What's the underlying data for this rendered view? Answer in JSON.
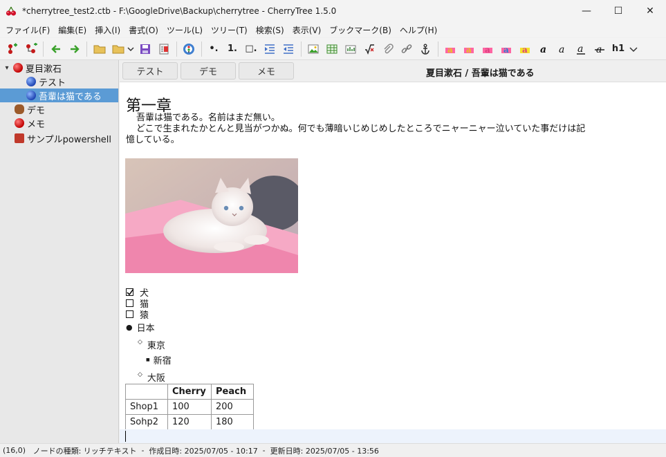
{
  "window": {
    "title": "*cherrytree_test2.ctb - F:\\GoogleDrive\\Backup\\cherrytree - CherryTree 1.5.0",
    "controls": {
      "minimize": "—",
      "maximize": "☐",
      "close": "✕"
    }
  },
  "menu": [
    "ファイル(F)",
    "編集(E)",
    "挿入(I)",
    "書式(O)",
    "ツール(L)",
    "ツリー(T)",
    "検索(S)",
    "表示(V)",
    "ブックマーク(B)",
    "ヘルプ(H)"
  ],
  "toolbar": {
    "heading_label": "h1",
    "list_bullet": "•.",
    "list_number": "1.",
    "list_todo": "□."
  },
  "tree": {
    "items": [
      {
        "label": "夏目漱石",
        "icon": "cherry-icon",
        "level": 0,
        "expanded": true
      },
      {
        "label": "テスト",
        "icon": "blueberry-icon",
        "level": 1
      },
      {
        "label": "吾輩は猫である",
        "icon": "blueberry-icon",
        "level": 1,
        "selected": true
      },
      {
        "label": "デモ",
        "icon": "bear-icon",
        "level": 0
      },
      {
        "label": "メモ",
        "icon": "cherry-icon",
        "level": 0
      },
      {
        "label": "サンプルpowershell",
        "icon": "terminal-icon",
        "level": 0
      }
    ]
  },
  "tabs": [
    "テスト",
    "デモ",
    "メモ"
  ],
  "node_path": "夏目漱石 / 吾輩は猫である",
  "document": {
    "heading": "第一章",
    "lines": [
      "吾輩は猫である。名前はまだ無い。",
      "どこで生まれたかとんと見当がつかぬ。何でも薄暗いじめじめしたところでニャーニャー泣いていた事だけは記",
      "憶している。"
    ],
    "image_alt": "white persian cat on pink cushion",
    "checklist": [
      {
        "label": "犬",
        "checked": true
      },
      {
        "label": "猫",
        "checked": false
      },
      {
        "label": "猿",
        "checked": false
      }
    ],
    "bullets": {
      "top": "日本",
      "sub1": "東京",
      "subsub1": "新宿",
      "sub2": "大阪"
    },
    "table": {
      "headers": [
        "",
        "Cherry",
        "Peach"
      ],
      "rows": [
        [
          "Shop1",
          "100",
          "200"
        ],
        [
          "Sohp2",
          "120",
          "180"
        ]
      ]
    }
  },
  "status": {
    "position": "(16,0)",
    "node_type": "ノードの種類: リッチテキスト",
    "created": "作成日時: 2025/07/05 - 10:17",
    "modified": "更新日時: 2025/07/05 - 13:56"
  },
  "colors": {
    "selection": "#5b9bd5",
    "current_line": "#edf3fc"
  }
}
